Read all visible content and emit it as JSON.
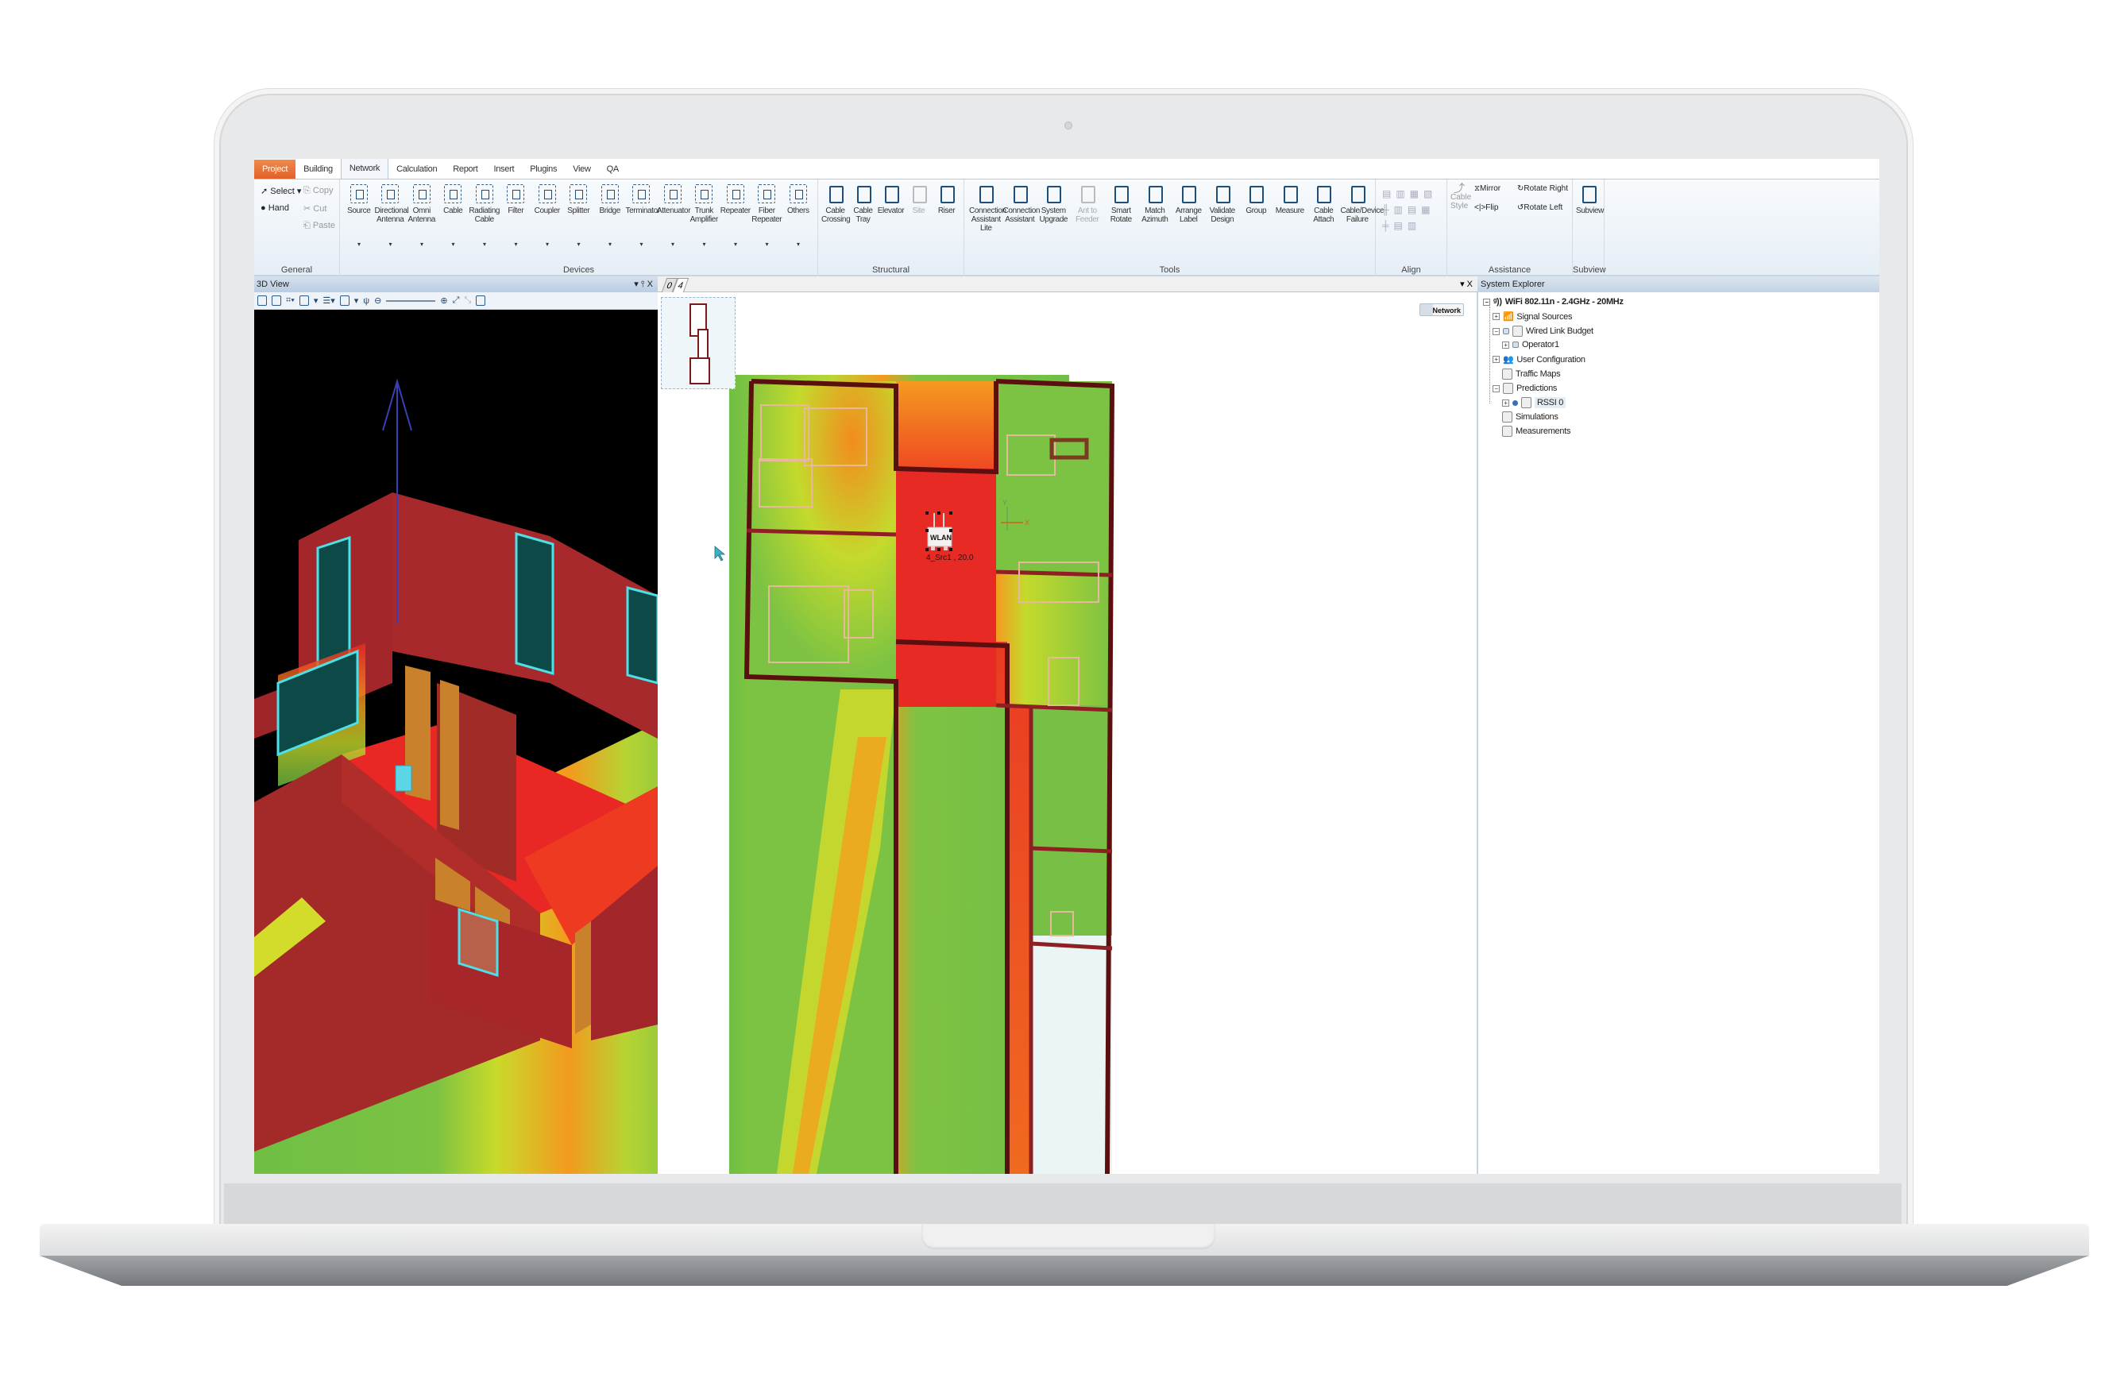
{
  "ribbon": {
    "tabs": [
      {
        "label": "Project",
        "state": "app-menu"
      },
      {
        "label": "Building",
        "state": "normal"
      },
      {
        "label": "Network",
        "state": "active"
      },
      {
        "label": "Calculation",
        "state": "normal"
      },
      {
        "label": "Report",
        "state": "normal"
      },
      {
        "label": "Insert",
        "state": "normal"
      },
      {
        "label": "Plugins",
        "state": "normal"
      },
      {
        "label": "View",
        "state": "normal"
      },
      {
        "label": "QA",
        "state": "normal"
      }
    ],
    "groups": {
      "general": {
        "label": "General",
        "select": "Select",
        "hand": "Hand",
        "copy": "Copy",
        "cut": "Cut",
        "paste": "Paste"
      },
      "devices": {
        "label": "Devices",
        "buttons": [
          {
            "line1": "Source",
            "line2": ""
          },
          {
            "line1": "Directional",
            "line2": "Antenna"
          },
          {
            "line1": "Omni",
            "line2": "Antenna"
          },
          {
            "line1": "Cable",
            "line2": ""
          },
          {
            "line1": "Radiating",
            "line2": "Cable"
          },
          {
            "line1": "Filter",
            "line2": ""
          },
          {
            "line1": "Coupler",
            "line2": ""
          },
          {
            "line1": "Splitter",
            "line2": ""
          },
          {
            "line1": "Bridge",
            "line2": ""
          },
          {
            "line1": "Terminator",
            "line2": ""
          },
          {
            "line1": "Attenuator",
            "line2": ""
          },
          {
            "line1": "Trunk",
            "line2": "Amplifier"
          },
          {
            "line1": "Repeater",
            "line2": ""
          },
          {
            "line1": "Fiber",
            "line2": "Repeater"
          },
          {
            "line1": "Others",
            "line2": ""
          }
        ]
      },
      "structural": {
        "label": "Structural",
        "buttons": [
          {
            "line1": "Cable",
            "line2": "Crossing",
            "enabled": true
          },
          {
            "line1": "Cable",
            "line2": "Tray",
            "enabled": true
          },
          {
            "line1": "Elevator",
            "line2": "",
            "enabled": true
          },
          {
            "line1": "Site",
            "line2": "",
            "enabled": false
          },
          {
            "line1": "Riser",
            "line2": "",
            "enabled": true
          }
        ]
      },
      "tools": {
        "label": "Tools",
        "buttons": [
          {
            "line1": "Connection",
            "line2": "Assistant Lite",
            "enabled": true
          },
          {
            "line1": "Connection",
            "line2": "Assistant",
            "enabled": true
          },
          {
            "line1": "System",
            "line2": "Upgrade",
            "enabled": true
          },
          {
            "line1": "Ant to",
            "line2": "Feeder",
            "enabled": false
          },
          {
            "line1": "Smart",
            "line2": "Rotate",
            "enabled": true
          },
          {
            "line1": "Match",
            "line2": "Azimuth",
            "enabled": true
          },
          {
            "line1": "Arrange",
            "line2": "Label",
            "enabled": true
          },
          {
            "line1": "Validate",
            "line2": "Design",
            "enabled": true
          },
          {
            "line1": "Group",
            "line2": "",
            "enabled": true
          },
          {
            "line1": "Measure",
            "line2": "",
            "enabled": true
          },
          {
            "line1": "Cable",
            "line2": "Attach",
            "enabled": true
          },
          {
            "line1": "Cable/Device",
            "line2": "Failure",
            "enabled": true
          }
        ]
      },
      "align": {
        "label": "Align"
      },
      "assistance": {
        "label": "Assistance",
        "cable_style": "Cable Style",
        "mirror": "Mirror",
        "flip": "Flip",
        "rotate_right": "Rotate Right",
        "rotate_left": "Rotate Left"
      },
      "subview": {
        "label": "Subview",
        "button": "Subview"
      }
    }
  },
  "view3d": {
    "title": "3D View",
    "controls": "▾ ⫯ X"
  },
  "view2d": {
    "tabs": [
      "0",
      "4"
    ],
    "active_tab": "4",
    "controls": "▾ X",
    "network_toggle": "Network",
    "device": {
      "label": "WLAN",
      "caption": "4_Src1 , 20.0"
    },
    "axis_x": "X",
    "axis_y": "Y"
  },
  "explorer": {
    "title": "System Explorer",
    "items": [
      {
        "label": "WiFi 802.11n - 2.4GHz - 20MHz",
        "level": 0,
        "expander": "−"
      },
      {
        "label": "Signal Sources",
        "level": 1,
        "expander": "+"
      },
      {
        "label": "Wired Link Budget",
        "level": 1,
        "expander": "−"
      },
      {
        "label": "Operator1",
        "level": 2,
        "expander": "+"
      },
      {
        "label": "User Configuration",
        "level": 1,
        "expander": "+"
      },
      {
        "label": "Traffic Maps",
        "level": 1,
        "expander": ""
      },
      {
        "label": "Predictions",
        "level": 1,
        "expander": "−"
      },
      {
        "label": "RSSI 0",
        "level": 2,
        "expander": "+",
        "selected": true
      },
      {
        "label": "Simulations",
        "level": 1,
        "expander": ""
      },
      {
        "label": "Measurements",
        "level": 1,
        "expander": ""
      }
    ]
  },
  "colors": {
    "accent_project_tab": "#e1602a",
    "heat_strong": "#e82a24",
    "heat_mid": "#f28c1e",
    "heat_weak": "#6fbf44",
    "wall": "#5c0f0f"
  }
}
